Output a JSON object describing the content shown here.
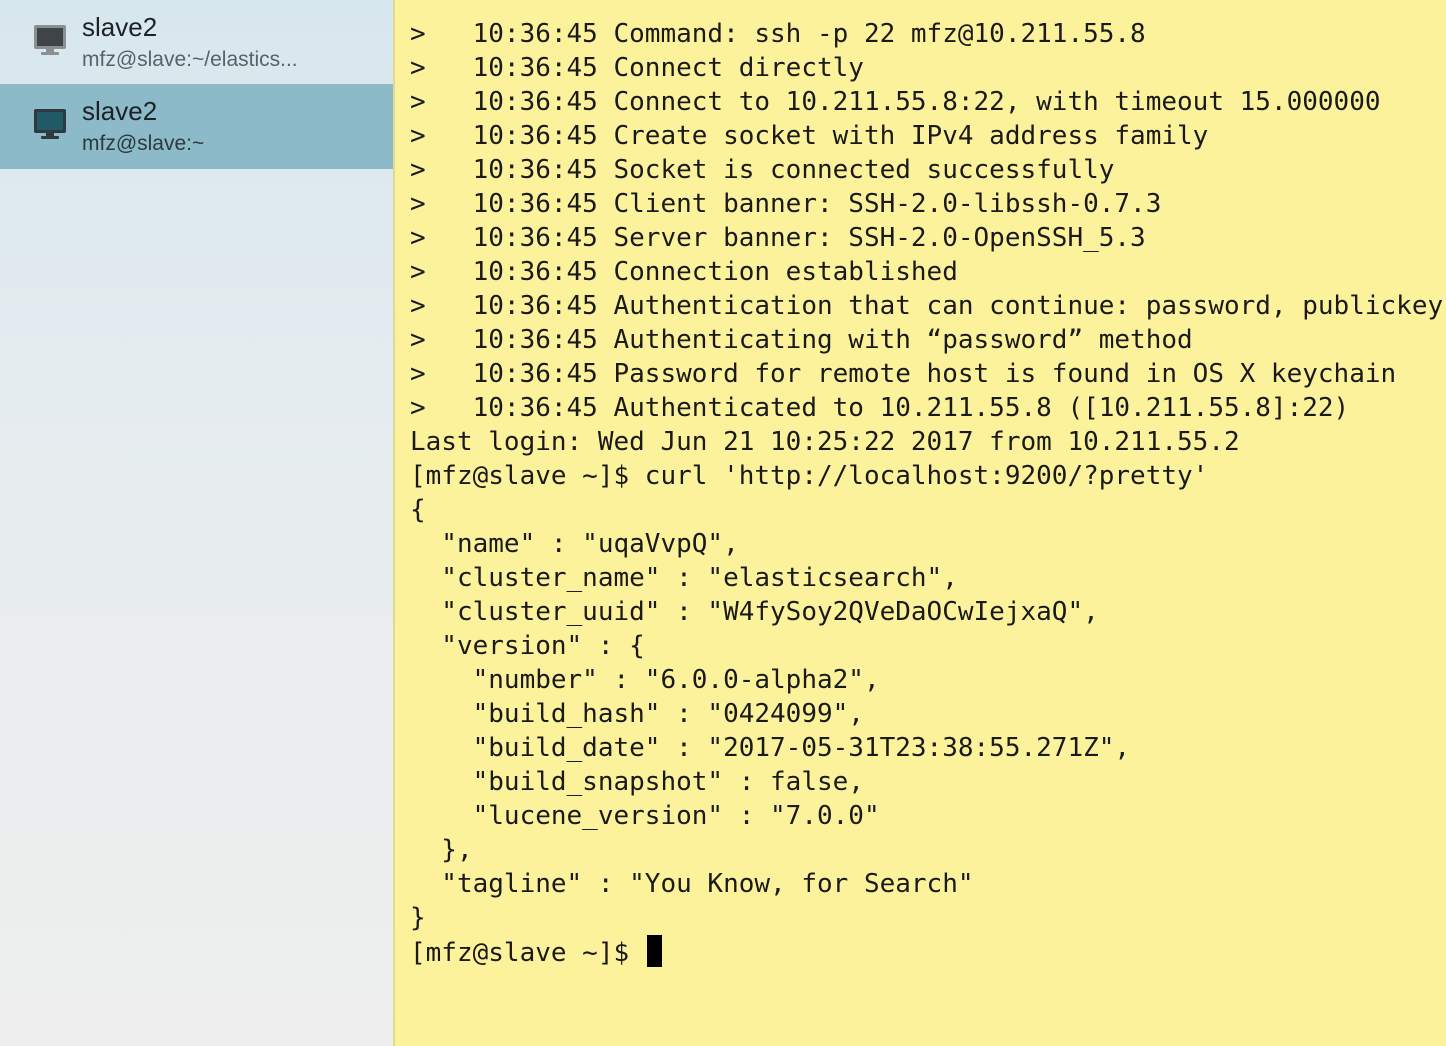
{
  "sidebar": {
    "sessions": [
      {
        "title": "slave2",
        "subtitle": "mfz@slave:~/elastics...",
        "icon": "monitor-icon",
        "selected": false
      },
      {
        "title": "slave2",
        "subtitle": "mfz@slave:~",
        "icon": "monitor-icon",
        "selected": true
      }
    ],
    "selected_color": "#8dbac9"
  },
  "terminal": {
    "background": "#fdf29c",
    "lines": [
      ">   10:36:45 Command: ssh -p 22 mfz@10.211.55.8",
      ">   10:36:45 Connect directly",
      ">   10:36:45 Connect to 10.211.55.8:22, with timeout 15.000000",
      ">   10:36:45 Create socket with IPv4 address family",
      ">   10:36:45 Socket is connected successfully",
      ">   10:36:45 Client banner: SSH-2.0-libssh-0.7.3",
      ">   10:36:45 Server banner: SSH-2.0-OpenSSH_5.3",
      ">   10:36:45 Connection established",
      ">   10:36:45 Authentication that can continue: password, publickey",
      ">   10:36:45 Authenticating with “password” method",
      ">   10:36:45 Password for remote host is found in OS X keychain",
      ">   10:36:45 Authenticated to 10.211.55.8 ([10.211.55.8]:22)",
      "Last login: Wed Jun 21 10:25:22 2017 from 10.211.55.2",
      "[mfz@slave ~]$ curl 'http://localhost:9200/?pretty'",
      "{",
      "  \"name\" : \"uqaVvpQ\",",
      "  \"cluster_name\" : \"elasticsearch\",",
      "  \"cluster_uuid\" : \"W4fySoy2QVeDaOCwIejxaQ\",",
      "  \"version\" : {",
      "    \"number\" : \"6.0.0-alpha2\",",
      "    \"build_hash\" : \"0424099\",",
      "    \"build_date\" : \"2017-05-31T23:38:55.271Z\",",
      "    \"build_snapshot\" : false,",
      "    \"lucene_version\" : \"7.0.0\"",
      "  },",
      "  \"tagline\" : \"You Know, for Search\"",
      "}"
    ],
    "prompt": "[mfz@slave ~]$ "
  }
}
